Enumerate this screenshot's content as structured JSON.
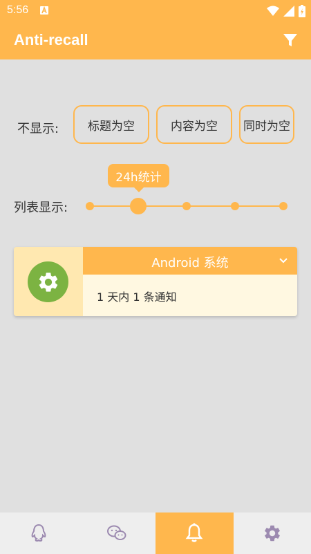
{
  "status_bar": {
    "time": "5:56"
  },
  "app_bar": {
    "title": "Anti-recall",
    "filter_icon": "filter-icon"
  },
  "hide_section": {
    "label": "不显示:",
    "options": [
      "标题为空",
      "内容为空",
      "同时为空"
    ]
  },
  "list_section": {
    "label": "列表显示:",
    "tooltip": "24h统计",
    "slider": {
      "steps": 5,
      "selected_index": 1
    }
  },
  "card": {
    "title": "Android 系统",
    "body": "1 天内 1 条通知",
    "icon": "settings-gear-icon"
  },
  "bottom_nav": {
    "tabs": [
      {
        "icon": "qq-icon",
        "active": false
      },
      {
        "icon": "wechat-icon",
        "active": false
      },
      {
        "icon": "bell-icon",
        "active": true
      },
      {
        "icon": "settings-icon",
        "active": false
      }
    ]
  },
  "colors": {
    "accent": "#ffb74d",
    "background": "#e0e0e0",
    "card_left": "#ffe8b0",
    "card_body": "#fff8e1",
    "app_icon": "#7cb342",
    "nav_icon": "#9c8ab0"
  }
}
